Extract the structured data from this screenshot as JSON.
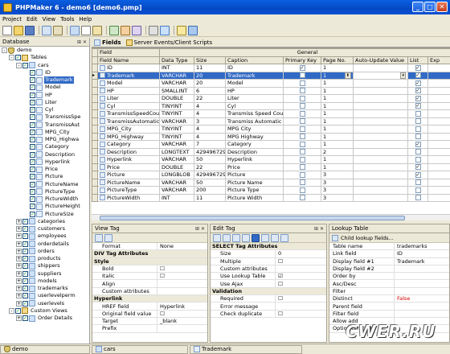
{
  "window": {
    "title": "PHPMaker 6 - demo6 [demo6.pmp]",
    "min": "_",
    "max": "□",
    "close": "✕"
  },
  "menu": [
    "Project",
    "Edit",
    "View",
    "Tools",
    "Help"
  ],
  "database_panel": {
    "title": "Database",
    "tree": [
      {
        "label": "demo",
        "level": 0,
        "exp": "-",
        "chk": false,
        "icon": "db"
      },
      {
        "label": "Tables",
        "level": 1,
        "exp": "-",
        "chk": true,
        "icon": "folder"
      },
      {
        "label": "cars",
        "level": 2,
        "exp": "-",
        "chk": true,
        "icon": "tbl"
      },
      {
        "label": "ID",
        "level": 3,
        "exp": "",
        "chk": true,
        "icon": "field"
      },
      {
        "label": "Trademark",
        "level": 3,
        "exp": "",
        "chk": true,
        "icon": "field",
        "selected": true
      },
      {
        "label": "Model",
        "level": 3,
        "exp": "",
        "chk": true,
        "icon": "field"
      },
      {
        "label": "HP",
        "level": 3,
        "exp": "",
        "chk": true,
        "icon": "field"
      },
      {
        "label": "Liter",
        "level": 3,
        "exp": "",
        "chk": true,
        "icon": "field"
      },
      {
        "label": "Cyl",
        "level": 3,
        "exp": "",
        "chk": true,
        "icon": "field"
      },
      {
        "label": "TransmissSpe",
        "level": 3,
        "exp": "",
        "chk": true,
        "icon": "field"
      },
      {
        "label": "TransmissAut",
        "level": 3,
        "exp": "",
        "chk": true,
        "icon": "field"
      },
      {
        "label": "MPG_City",
        "level": 3,
        "exp": "",
        "chk": true,
        "icon": "field"
      },
      {
        "label": "MPG_Highwa",
        "level": 3,
        "exp": "",
        "chk": true,
        "icon": "field"
      },
      {
        "label": "Category",
        "level": 3,
        "exp": "",
        "chk": true,
        "icon": "field"
      },
      {
        "label": "Description",
        "level": 3,
        "exp": "",
        "chk": true,
        "icon": "field"
      },
      {
        "label": "Hyperlink",
        "level": 3,
        "exp": "",
        "chk": true,
        "icon": "field"
      },
      {
        "label": "Price",
        "level": 3,
        "exp": "",
        "chk": true,
        "icon": "field"
      },
      {
        "label": "Picture",
        "level": 3,
        "exp": "",
        "chk": true,
        "icon": "field"
      },
      {
        "label": "PictureName",
        "level": 3,
        "exp": "",
        "chk": true,
        "icon": "field"
      },
      {
        "label": "PictureType",
        "level": 3,
        "exp": "",
        "chk": true,
        "icon": "field"
      },
      {
        "label": "PictureWidth",
        "level": 3,
        "exp": "",
        "chk": true,
        "icon": "field"
      },
      {
        "label": "PictureHeight",
        "level": 3,
        "exp": "",
        "chk": true,
        "icon": "field"
      },
      {
        "label": "PictureSize",
        "level": 3,
        "exp": "",
        "chk": true,
        "icon": "field"
      },
      {
        "label": "categories",
        "level": 2,
        "exp": "+",
        "chk": true,
        "icon": "tbl"
      },
      {
        "label": "customers",
        "level": 2,
        "exp": "+",
        "chk": true,
        "icon": "tbl"
      },
      {
        "label": "employees",
        "level": 2,
        "exp": "+",
        "chk": true,
        "icon": "tbl"
      },
      {
        "label": "orderdetails",
        "level": 2,
        "exp": "+",
        "chk": true,
        "icon": "tbl"
      },
      {
        "label": "orders",
        "level": 2,
        "exp": "+",
        "chk": true,
        "icon": "tbl"
      },
      {
        "label": "products",
        "level": 2,
        "exp": "+",
        "chk": true,
        "icon": "tbl"
      },
      {
        "label": "shippers",
        "level": 2,
        "exp": "+",
        "chk": true,
        "icon": "tbl"
      },
      {
        "label": "suppliers",
        "level": 2,
        "exp": "+",
        "chk": true,
        "icon": "tbl"
      },
      {
        "label": "models",
        "level": 2,
        "exp": "+",
        "chk": true,
        "icon": "tbl"
      },
      {
        "label": "trademarks",
        "level": 2,
        "exp": "+",
        "chk": true,
        "icon": "tbl"
      },
      {
        "label": "userlevelperm",
        "level": 2,
        "exp": "+",
        "chk": true,
        "icon": "tbl"
      },
      {
        "label": "userlevels",
        "level": 2,
        "exp": "+",
        "chk": true,
        "icon": "tbl"
      },
      {
        "label": "Custom Views",
        "level": 1,
        "exp": "-",
        "chk": true,
        "icon": "folder"
      },
      {
        "label": "Order Details",
        "level": 2,
        "exp": "+",
        "chk": true,
        "icon": "tbl"
      }
    ]
  },
  "fields_panel": {
    "tabs": [
      "Fields",
      "Server Events/Client Scripts"
    ],
    "group_headers": {
      "field": "Field",
      "general": "General"
    },
    "columns": [
      "Field Name",
      "Data Type",
      "Size",
      "Caption",
      "Primary Key",
      "Page No.",
      "Auto-Update Value",
      "List",
      "Exp"
    ],
    "rows": [
      {
        "name": "ID",
        "type": "INT",
        "size": "11",
        "caption": "ID",
        "pk": true,
        "page": "1",
        "list": true
      },
      {
        "name": "Trademark",
        "type": "VARCHAR",
        "size": "20",
        "caption": "Trademark",
        "pk": false,
        "page": "1",
        "list": true,
        "selected": true
      },
      {
        "name": "Model",
        "type": "VARCHAR",
        "size": "20",
        "caption": "Model",
        "pk": false,
        "page": "1",
        "list": true
      },
      {
        "name": "HP",
        "type": "SMALLINT",
        "size": "6",
        "caption": "HP",
        "pk": false,
        "page": "1",
        "list": true
      },
      {
        "name": "Liter",
        "type": "DOUBLE",
        "size": "22",
        "caption": "Liter",
        "pk": false,
        "page": "1",
        "list": true
      },
      {
        "name": "Cyl",
        "type": "TINYINT",
        "size": "4",
        "caption": "Cyl",
        "pk": false,
        "page": "1",
        "list": true
      },
      {
        "name": "TransmissSpeedCount",
        "type": "TINYINT",
        "size": "4",
        "caption": "Transmiss Speed Count",
        "pk": false,
        "page": "1",
        "list": false
      },
      {
        "name": "TransmissAutomatic",
        "type": "VARCHAR",
        "size": "3",
        "caption": "Transmiss Automatic",
        "pk": false,
        "page": "1",
        "list": false
      },
      {
        "name": "MPG_City",
        "type": "TINYINT",
        "size": "4",
        "caption": "MPG City",
        "pk": false,
        "page": "1",
        "list": false
      },
      {
        "name": "MPG_Highway",
        "type": "TINYINT",
        "size": "4",
        "caption": "MPG Highway",
        "pk": false,
        "page": "1",
        "list": false
      },
      {
        "name": "Category",
        "type": "VARCHAR",
        "size": "7",
        "caption": "Category",
        "pk": false,
        "page": "1",
        "list": true
      },
      {
        "name": "Description",
        "type": "LONGTEXT",
        "size": "4294967295",
        "caption": "Description",
        "pk": false,
        "page": "2",
        "list": false
      },
      {
        "name": "Hyperlink",
        "type": "VARCHAR",
        "size": "50",
        "caption": "Hyperlink",
        "pk": false,
        "page": "1",
        "list": false
      },
      {
        "name": "Price",
        "type": "DOUBLE",
        "size": "22",
        "caption": "Price",
        "pk": false,
        "page": "1",
        "list": true
      },
      {
        "name": "Picture",
        "type": "LONGBLOB",
        "size": "4294967295",
        "caption": "Picture",
        "pk": false,
        "page": "3",
        "list": true
      },
      {
        "name": "PictureName",
        "type": "VARCHAR",
        "size": "50",
        "caption": "Picture Name",
        "pk": false,
        "page": "3",
        "list": false
      },
      {
        "name": "PictureType",
        "type": "VARCHAR",
        "size": "200",
        "caption": "Picture Type",
        "pk": false,
        "page": "3",
        "list": false
      },
      {
        "name": "PictureWidth",
        "type": "INT",
        "size": "11",
        "caption": "Picture Width",
        "pk": false,
        "page": "3",
        "list": false
      }
    ]
  },
  "view_tag": {
    "title": "View Tag",
    "rows": [
      {
        "k": "Format",
        "v": "None",
        "cat": false
      },
      {
        "k": "DIV Tag Attributes",
        "v": "",
        "cat": true
      },
      {
        "k": "Style",
        "v": "",
        "cat": true
      },
      {
        "k": "Bold",
        "v": "☐",
        "cat": false
      },
      {
        "k": "Italic",
        "v": "☐",
        "cat": false
      },
      {
        "k": "Align",
        "v": "",
        "cat": false
      },
      {
        "k": "Custom attributes",
        "v": "",
        "cat": false
      },
      {
        "k": "Hyperlink",
        "v": "",
        "cat": true
      },
      {
        "k": "HREF field",
        "v": "Hyperlink",
        "cat": false
      },
      {
        "k": "Original field value",
        "v": "☐",
        "cat": false
      },
      {
        "k": "Target",
        "v": "_blank",
        "cat": false
      },
      {
        "k": "Prefix",
        "v": "",
        "cat": false
      }
    ]
  },
  "edit_tag": {
    "title": "Edit Tag",
    "rows": [
      {
        "k": "SELECT Tag Attributes",
        "v": "",
        "cat": true
      },
      {
        "k": "Size",
        "v": "0",
        "cat": false
      },
      {
        "k": "Multiple",
        "v": "☐",
        "cat": false
      },
      {
        "k": "Custom attributes",
        "v": "",
        "cat": false
      },
      {
        "k": "Use Lookup Table",
        "v": "☑",
        "cat": false
      },
      {
        "k": "Use Ajax",
        "v": "☐",
        "cat": false
      },
      {
        "k": "Validation",
        "v": "",
        "cat": true
      },
      {
        "k": "Required",
        "v": "☐",
        "cat": false
      },
      {
        "k": "Error message",
        "v": "",
        "cat": false
      },
      {
        "k": "Check duplicate",
        "v": "☐",
        "cat": false
      }
    ]
  },
  "lookup_table": {
    "title": "Lookup Table",
    "child_btn": "Child lookup fields...",
    "rows": [
      {
        "k": "Table name",
        "v": "trademarks",
        "red": false
      },
      {
        "k": "Link field",
        "v": "ID",
        "red": false
      },
      {
        "k": "Display field #1",
        "v": "Trademark",
        "red": false
      },
      {
        "k": "Display field #2",
        "v": "",
        "red": false
      },
      {
        "k": "Order by",
        "v": "",
        "red": false
      },
      {
        "k": "Asc/Desc",
        "v": "",
        "red": false
      },
      {
        "k": "Filter",
        "v": "",
        "red": false
      },
      {
        "k": "Distinct",
        "v": "False",
        "red": true
      },
      {
        "k": "Parent field",
        "v": "",
        "red": false
      },
      {
        "k": "Filter field",
        "v": "",
        "red": false
      },
      {
        "k": "Allow add",
        "v": "",
        "red": false
      },
      {
        "k": "Option template",
        "v": "",
        "red": false
      }
    ]
  },
  "status": {
    "db": "demo",
    "table": "cars",
    "field": "Trademark"
  },
  "watermark": "CWER.RU",
  "colors": {
    "selection": "#316ac5",
    "titlebar": "#0548c4",
    "false_value": "#d40000"
  }
}
